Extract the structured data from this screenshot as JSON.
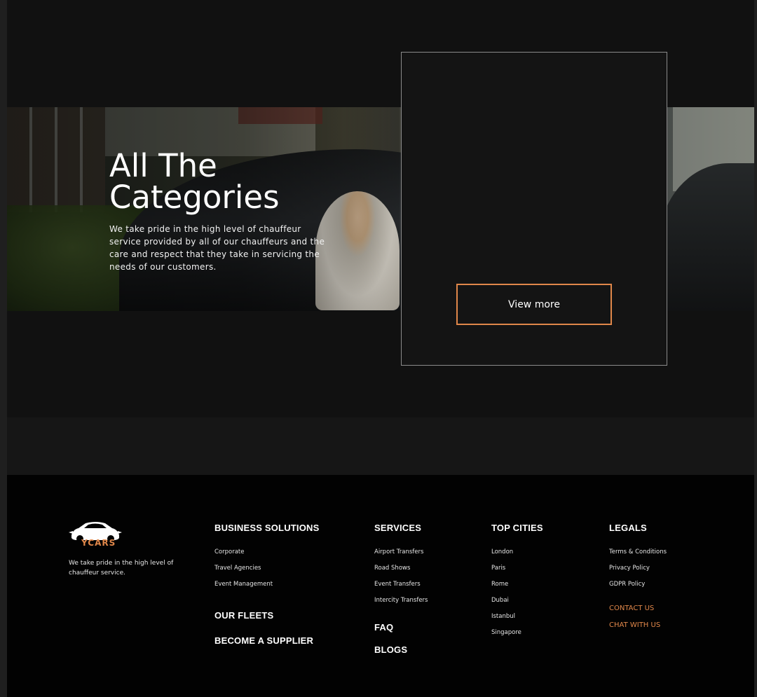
{
  "hero": {
    "title": "All The Categories",
    "description": "We take pride in the high level of chauffeur service provided by all of our chauffeurs and the care and respect that they take in servicing the needs of our customers."
  },
  "card": {
    "button_label": "View more"
  },
  "colors": {
    "accent": "#e0874a",
    "background": "#111111",
    "footer_background": "#020202"
  },
  "footer": {
    "logo_text": "YCARS",
    "tagline": "We take pride in the high level of chauffeur service.",
    "business": {
      "heading": "BUSINESS SOLUTIONS",
      "links": [
        "Corporate",
        "Travel Agencies",
        "Event Management"
      ],
      "our_fleets": "OUR FLEETS",
      "become_supplier": "BECOME A SUPPLIER"
    },
    "services": {
      "heading": "SERVICES",
      "links": [
        "Airport Transfers",
        "Road Shows",
        "Event Transfers",
        "Intercity Transfers"
      ],
      "faq": "FAQ",
      "blogs": "BLOGS"
    },
    "cities": {
      "heading": "TOP CITIES",
      "links": [
        "London",
        "Paris",
        "Rome",
        "Dubai",
        "Istanbul",
        "Singapore"
      ]
    },
    "legals": {
      "heading": "LEGALS",
      "links": [
        "Terms & Conditions",
        "Privacy Policy",
        "GDPR Policy"
      ],
      "contact": "CONTACT US",
      "chat": "CHAT WITH US"
    }
  }
}
